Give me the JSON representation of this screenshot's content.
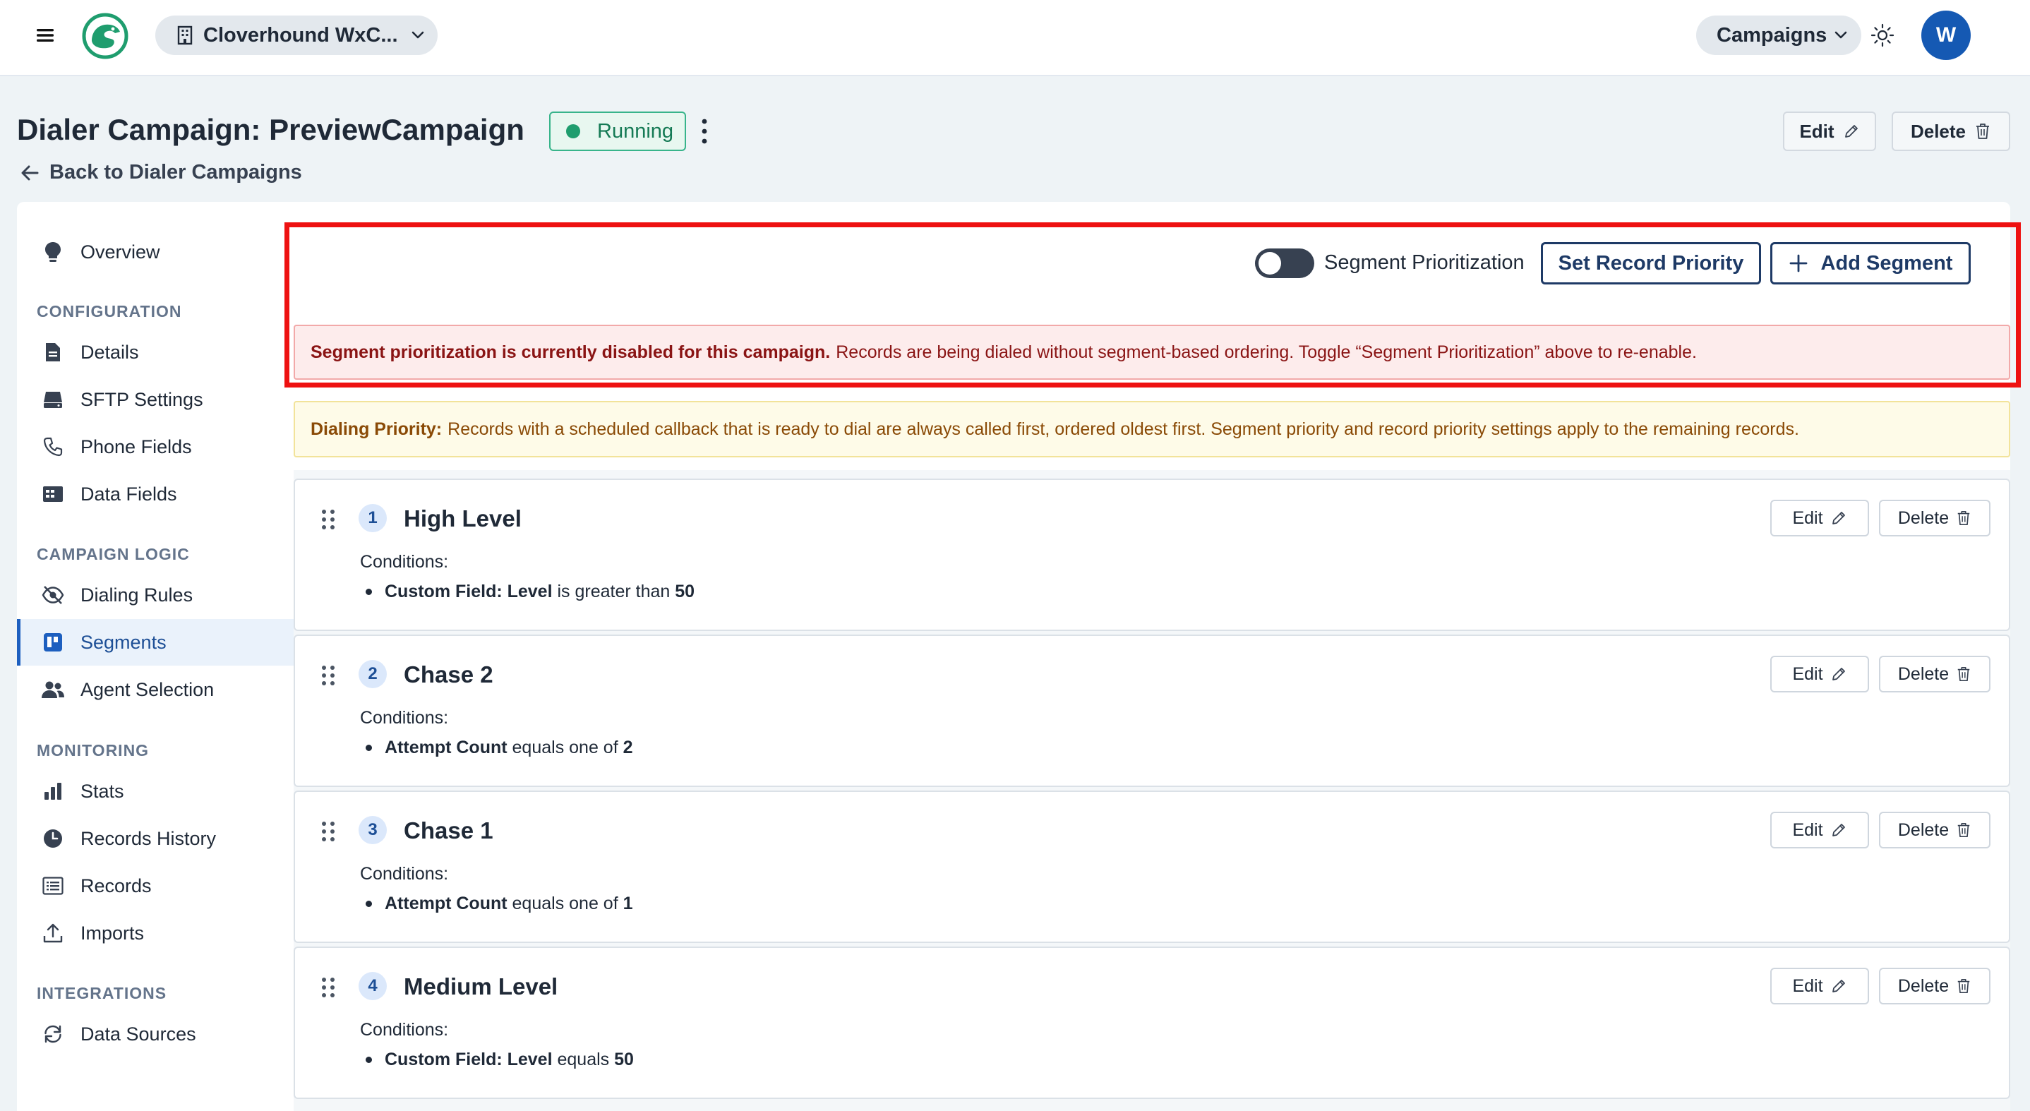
{
  "topbar": {
    "org_name": "Cloverhound WxC...",
    "nav_menu": "Campaigns",
    "avatar_initial": "W"
  },
  "header": {
    "title": "Dialer Campaign: PreviewCampaign",
    "status": "Running",
    "edit_label": "Edit",
    "delete_label": "Delete",
    "back_label": "Back to Dialer Campaigns"
  },
  "sidebar": {
    "overview": "Overview",
    "sections": {
      "configuration": "CONFIGURATION",
      "campaign_logic": "CAMPAIGN LOGIC",
      "monitoring": "MONITORING",
      "integrations": "INTEGRATIONS"
    },
    "items": {
      "details": "Details",
      "sftp": "SFTP Settings",
      "phone_fields": "Phone Fields",
      "data_fields": "Data Fields",
      "dialing_rules": "Dialing Rules",
      "segments": "Segments",
      "agent_selection": "Agent Selection",
      "stats": "Stats",
      "records_history": "Records History",
      "records": "Records",
      "imports": "Imports",
      "data_sources": "Data Sources"
    },
    "active": "Segments"
  },
  "toolbar": {
    "toggle_label": "Segment Prioritization",
    "toggle_on": false,
    "set_priority_label": "Set Record Priority",
    "add_segment_label": "Add Segment"
  },
  "alerts": {
    "disabled_bold": "Segment prioritization is currently disabled for this campaign.",
    "disabled_text": "Records are being dialed without segment-based ordering. Toggle “Segment Prioritization” above to re-enable.",
    "priority_bold": "Dialing Priority:",
    "priority_text": "Records with a scheduled callback that is ready to dial are always called first, ordered oldest first. Segment priority and record priority settings apply to the remaining records."
  },
  "segments": [
    {
      "number": "1",
      "name": "High Level",
      "conditions_label": "Conditions:",
      "field": "Custom Field: Level",
      "operator": "is greater than",
      "value": "50"
    },
    {
      "number": "2",
      "name": "Chase 2",
      "conditions_label": "Conditions:",
      "field": "Attempt Count",
      "operator": "equals one of",
      "value": "2"
    },
    {
      "number": "3",
      "name": "Chase 1",
      "conditions_label": "Conditions:",
      "field": "Attempt Count",
      "operator": "equals one of",
      "value": "1"
    },
    {
      "number": "4",
      "name": "Medium Level",
      "conditions_label": "Conditions:",
      "field": "Custom Field: Level",
      "operator": "equals",
      "value": "50"
    }
  ],
  "segment_actions": {
    "edit": "Edit",
    "delete": "Delete"
  },
  "colors": {
    "accent": "#1d5fbf",
    "running": "#1f9d6e",
    "alert_red_bg": "#fdecec",
    "alert_yellow_bg": "#fefbe8",
    "highlight": "#ee1111"
  }
}
